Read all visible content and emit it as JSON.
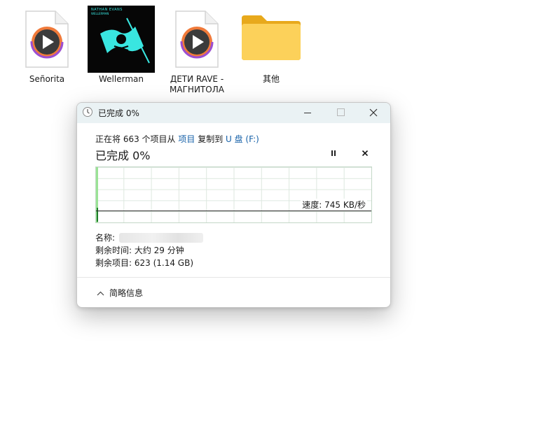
{
  "desktop": {
    "icons": [
      {
        "label": "Señorita",
        "type": "media-file"
      },
      {
        "label": "Wellerman",
        "type": "album-art",
        "art_artist": "NATHAN EVANS",
        "art_title": "WELLERMAN"
      },
      {
        "label": "ДЕТИ RAVE - МАГНИТОЛА",
        "type": "media-file"
      },
      {
        "label": "其他",
        "type": "folder"
      }
    ]
  },
  "dialog": {
    "title": "已完成 0%",
    "desc_prefix": "正在将 663 个项目从 ",
    "source": "项目",
    "desc_middle": " 复制到 ",
    "destination": "U 盘 (F:)",
    "status": "已完成 0%",
    "progress": 0,
    "speed": "速度: 745 KB/秒",
    "name_label": "名称:",
    "time_remaining": "剩余时间: 大约 29 分钟",
    "items_remaining": "剩余项目: 623 (1.14 GB)",
    "less_details": "简略信息"
  },
  "colors": {
    "accent_link": "#1560a8",
    "titlebar": "#eaf2f4",
    "progress_green": "#9be396",
    "grid": "#dde8df"
  },
  "icons": {
    "title_icon": "clock-icon",
    "pause": "pause-icon",
    "stop": "close-icon",
    "toggle": "chevron-up-icon"
  }
}
